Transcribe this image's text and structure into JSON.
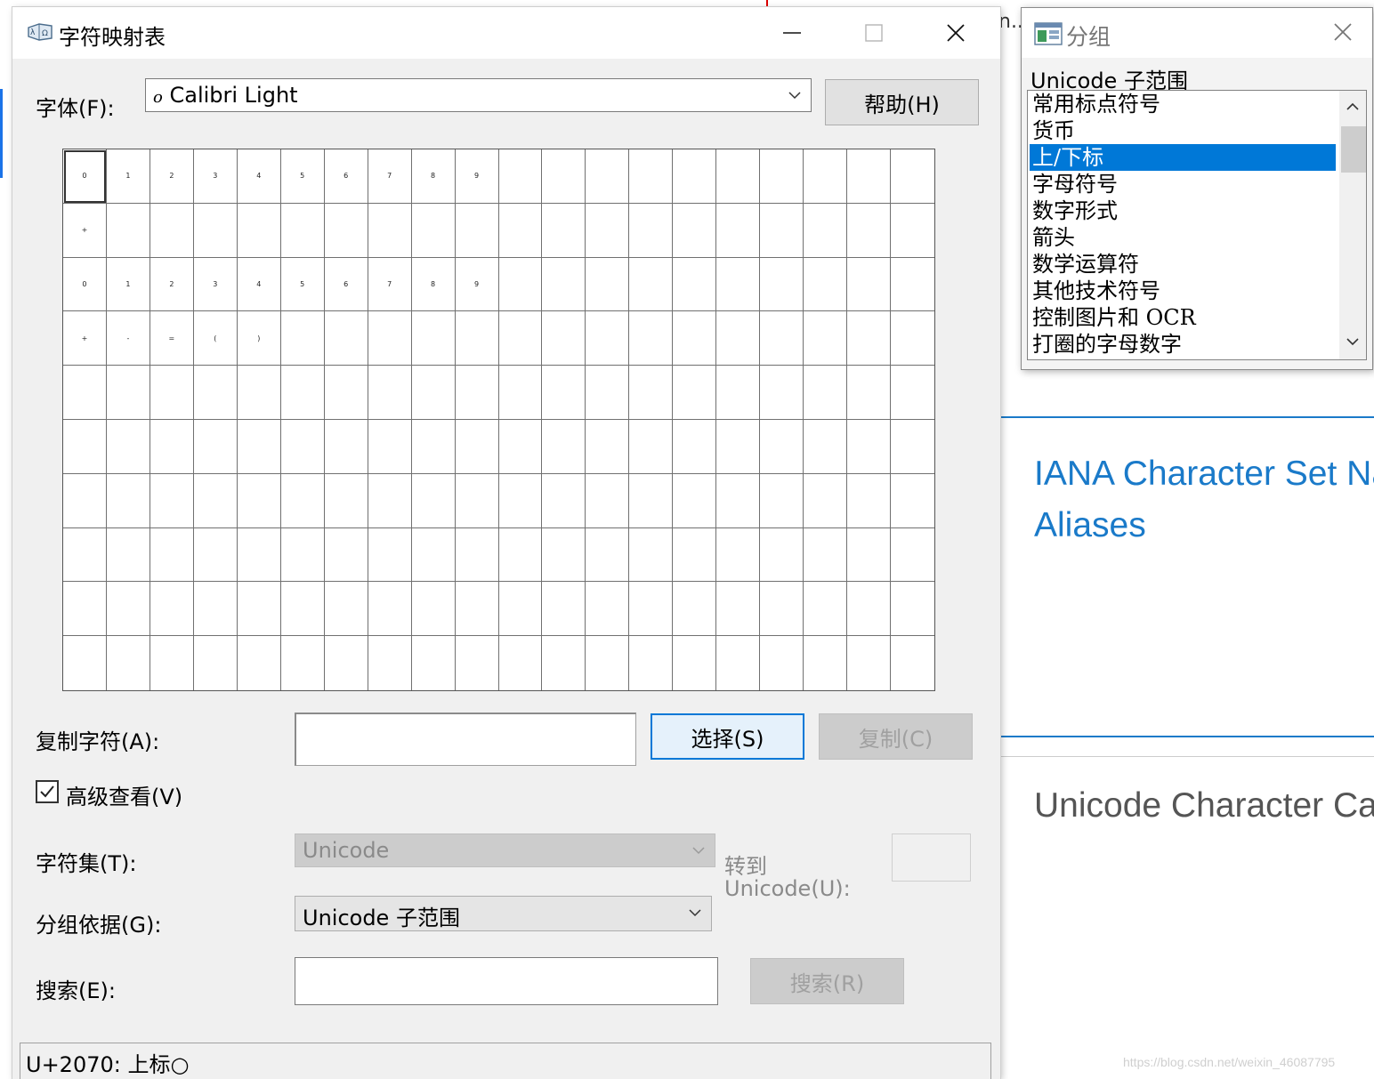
{
  "main_window": {
    "title": "字符映射表",
    "font_label": "字体(F):",
    "font_value": "Calibri Light",
    "font_glyph": "o",
    "help_button": "帮助(H)",
    "copy_label": "复制字符(A):",
    "copy_value": "",
    "select_button": "选择(S)",
    "copy_button": "复制(C)",
    "advanced_view_label": "高级查看(V)",
    "advanced_view_checked": true,
    "charset_label": "字符集(T):",
    "charset_value": "Unicode",
    "goto_label_1": "转到",
    "goto_label_2": "Unicode(U):",
    "groupby_label": "分组依据(G):",
    "groupby_value": "Unicode 子范围",
    "search_label": "搜索(E):",
    "search_button": "搜索(R)",
    "status_text": "U+2070: 上标○"
  },
  "char_grid": {
    "columns": 20,
    "rows": 10,
    "chars": [
      [
        "0",
        "1",
        "2",
        "3",
        "4",
        "5",
        "6",
        "7",
        "8",
        "9"
      ],
      [
        "+"
      ],
      [
        "0",
        "1",
        "2",
        "3",
        "4",
        "5",
        "6",
        "7",
        "8",
        "9"
      ],
      [
        "+",
        "-",
        "=",
        "(",
        ")"
      ]
    ]
  },
  "group_window": {
    "title": "分组",
    "header": "Unicode 子范围",
    "items": [
      "常用标点符号",
      "货币",
      "上/下标",
      "字母符号",
      "数字形式",
      "箭头",
      "数学运算符",
      "其他技术符号",
      "控制图片和 OCR",
      "打圈的字母数字"
    ],
    "selected_index": 2
  },
  "background_page": {
    "ellipsis": "n...",
    "heading1_line1": "IANA Character Set Nar",
    "heading1_line2": "Aliases",
    "heading2": "Unicode Character Cat",
    "watermark": "https://blog.csdn.net/weixin_46087795"
  },
  "colors": {
    "selection": "#0078d7",
    "link_heading": "#1a7ac9"
  }
}
